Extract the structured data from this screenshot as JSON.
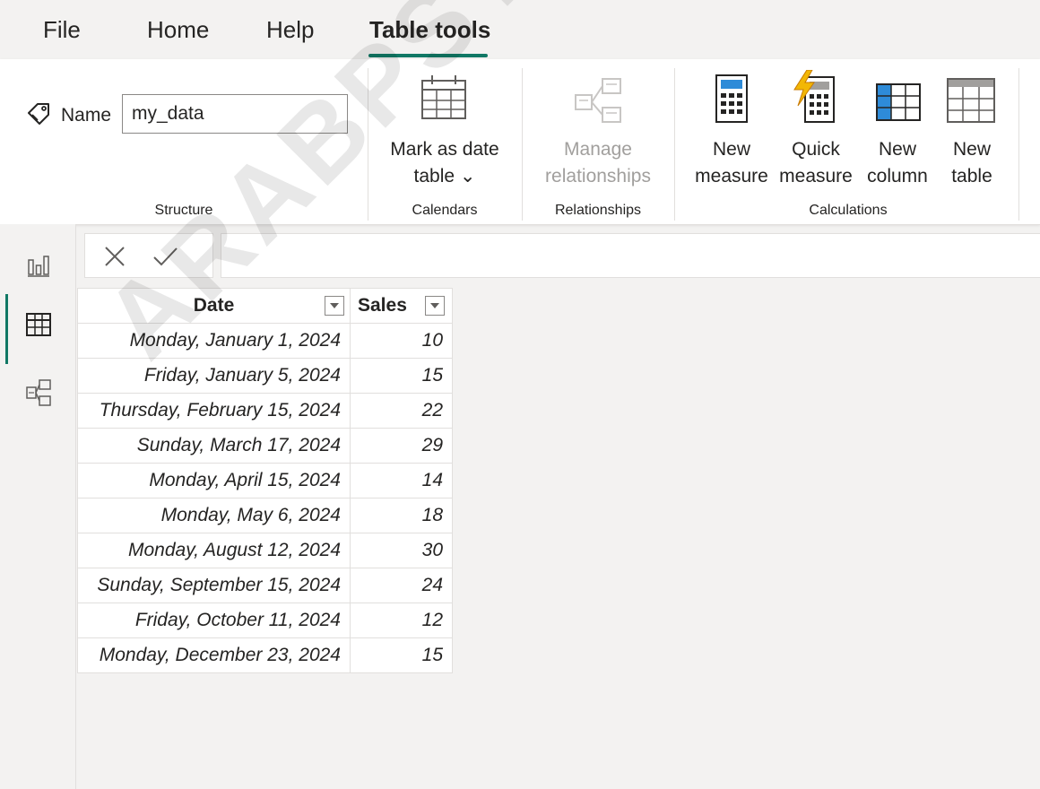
{
  "tabs": [
    {
      "label": "File"
    },
    {
      "label": "Home"
    },
    {
      "label": "Help"
    },
    {
      "label": "Table tools",
      "active": true
    }
  ],
  "ribbon": {
    "structure": {
      "name_label": "Name",
      "name_value": "my_data",
      "group_label": "Structure"
    },
    "calendars": {
      "mark_date_line1": "Mark as date",
      "mark_date_line2": "table ⌄",
      "group_label": "Calendars"
    },
    "relationships": {
      "manage_line1": "Manage",
      "manage_line2": "relationships",
      "group_label": "Relationships"
    },
    "calculations": {
      "new_measure_line1": "New",
      "new_measure_line2": "measure",
      "quick_measure_line1": "Quick",
      "quick_measure_line2": "measure",
      "new_column_line1": "New",
      "new_column_line2": "column",
      "new_table_line1": "New",
      "new_table_line2": "table",
      "group_label": "Calculations"
    }
  },
  "nav": {
    "items": [
      {
        "icon": "report-view-icon"
      },
      {
        "icon": "table-view-icon",
        "active": true
      },
      {
        "icon": "model-view-icon"
      }
    ]
  },
  "formula_bar": {
    "cancel_icon": "close-icon",
    "commit_icon": "check-icon",
    "value": ""
  },
  "table": {
    "columns": [
      "Date",
      "Sales"
    ],
    "rows": [
      [
        "Monday, January 1, 2024",
        "10"
      ],
      [
        "Friday, January 5, 2024",
        "15"
      ],
      [
        "Thursday, February 15, 2024",
        "22"
      ],
      [
        "Sunday, March 17, 2024",
        "29"
      ],
      [
        "Monday, April 15, 2024",
        "14"
      ],
      [
        "Monday, May 6, 2024",
        "18"
      ],
      [
        "Monday, August 12, 2024",
        "30"
      ],
      [
        "Sunday, September 15, 2024",
        "24"
      ],
      [
        "Friday, October 11, 2024",
        "12"
      ],
      [
        "Monday, December 23, 2024",
        "15"
      ]
    ]
  },
  "watermark": "ARABPSYCHO",
  "colors": {
    "accent": "#117865",
    "disabled_text": "#a19f9d",
    "column_blue": "#2e8bd8"
  }
}
